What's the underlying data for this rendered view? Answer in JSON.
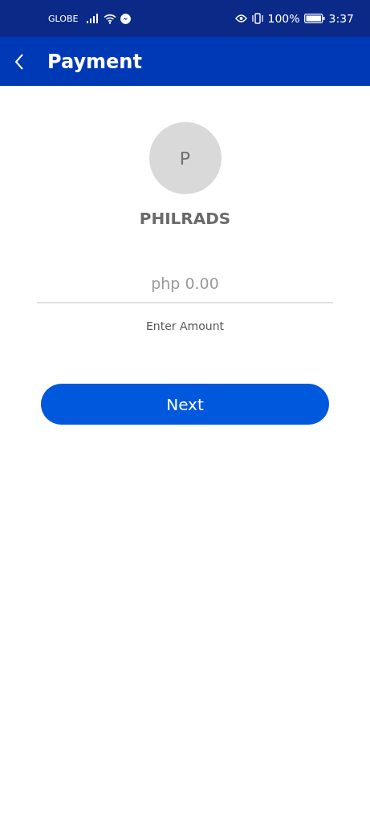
{
  "status_bar": {
    "carrier": "GLOBE",
    "battery_percent": "100%",
    "time": "3:37"
  },
  "app_bar": {
    "title": "Payment"
  },
  "recipient": {
    "initial": "P",
    "name": "PHILRADS"
  },
  "amount_field": {
    "placeholder": "php 0.00",
    "label": "Enter Amount"
  },
  "next_button": {
    "label": "Next"
  }
}
